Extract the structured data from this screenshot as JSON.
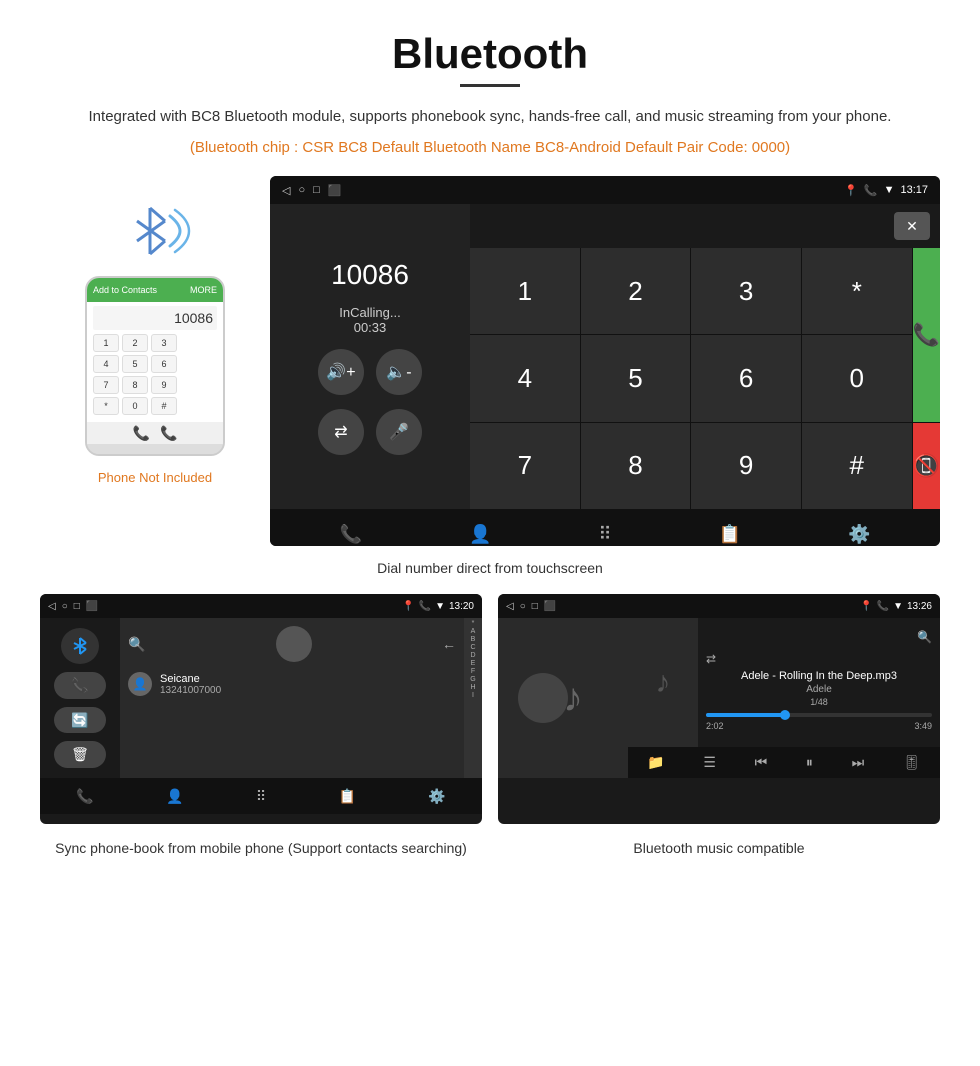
{
  "page": {
    "title": "Bluetooth",
    "description": "Integrated with BC8 Bluetooth module, supports phonebook sync, hands-free call, and music streaming from your phone.",
    "orange_text": "(Bluetooth chip : CSR BC8    Default Bluetooth Name BC8-Android    Default Pair Code: 0000)",
    "phone_not_included": "Phone Not Included",
    "dial_caption": "Dial number direct from touchscreen",
    "phonebook_caption": "Sync phone-book from mobile phone\n(Support contacts searching)",
    "music_caption": "Bluetooth music compatible"
  },
  "dial_screen": {
    "time": "13:17",
    "number": "10086",
    "status": "InCalling...",
    "call_duration": "00:33"
  },
  "phonebook_screen": {
    "time": "13:20",
    "contact_name": "Seicane",
    "contact_number": "13241007000",
    "alphabet": [
      "*",
      "A",
      "B",
      "C",
      "D",
      "E",
      "F",
      "G",
      "H",
      "I"
    ]
  },
  "music_screen": {
    "time": "13:26",
    "song_title": "Adele - Rolling In the Deep.mp3",
    "artist": "Adele",
    "track_info": "1/48",
    "current_time": "2:02",
    "total_time": "3:49",
    "progress_percent": 35
  },
  "keypad": {
    "keys": [
      "1",
      "2",
      "3",
      "*",
      "4",
      "5",
      "6",
      "0",
      "7",
      "8",
      "9",
      "#"
    ]
  },
  "status_bar": {
    "back": "◁",
    "home": "○",
    "recents": "□"
  }
}
